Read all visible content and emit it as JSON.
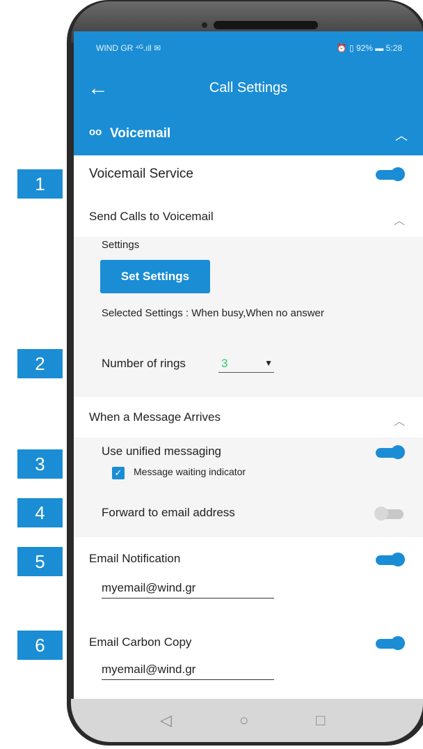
{
  "status": {
    "left": "WIND GR ⁴ᴳ.ıll ✉",
    "right": "⏰ ▯ 92% ▬ 5:28"
  },
  "appbar": {
    "back_icon": "back-arrow-icon",
    "title": "Call Settings"
  },
  "voicemail_section": {
    "icon": "voicemail-icon",
    "label": "Voicemail"
  },
  "voicemail_service": {
    "label": "Voicemail Service",
    "enabled": true
  },
  "send_calls": {
    "label": "Send Calls to Voicemail",
    "settings_label": "Settings",
    "set_settings_button": "Set Settings",
    "selected_settings": "Selected Settings : When busy,When no answer",
    "rings_label": "Number of rings",
    "rings_value": "3"
  },
  "message_arrives": {
    "label": "When a Message Arrives",
    "unified_label": "Use unified messaging",
    "unified_enabled": true,
    "mwi_label": "Message waiting indicator",
    "mwi_checked": true,
    "forward_label": "Forward to email address",
    "forward_enabled": false
  },
  "email_notification": {
    "label": "Email Notification",
    "enabled": true,
    "value": "myemail@wind.gr"
  },
  "email_cc": {
    "label": "Email Carbon Copy",
    "enabled": true,
    "value": "myemail@wind.gr"
  },
  "callouts": [
    "1",
    "2",
    "3",
    "4",
    "5",
    "6"
  ],
  "navbar": {
    "back": "◁",
    "home": "○",
    "recents": "□"
  },
  "colors": {
    "accent": "#1a8dd4",
    "rings_value": "#2ecc71",
    "toggle_off": "#c8c8c8"
  }
}
